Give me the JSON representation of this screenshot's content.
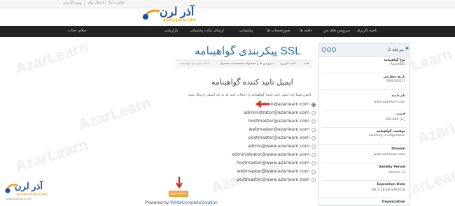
{
  "watermark": {
    "text": "AzarLearn"
  },
  "topbar": {
    "links": [
      "ورود کاربران",
      "ارسال پیام",
      "تماس با ما"
    ]
  },
  "logo": {
    "text": "آذر لرن",
    "subtext": "AZARLEARN.COM"
  },
  "navbar": {
    "items": [
      "ناحیه کاربری",
      "سرویس های من",
      "دامنه ها",
      "صورتحساب ها",
      "پشتیبانی",
      "ارسال تیکت پشتیبانی",
      "بازاریابی",
      "سلام، جناب"
    ]
  },
  "page": {
    "title": "پیکربندی گواهینامه SSL",
    "breadcrumb": [
      "پیکربندی گواهینامه SSL",
      "مشخصات محصول",
      "سرویس ها و محصولات",
      "ناحیه کاربری",
      "خانه"
    ]
  },
  "section": {
    "title": "ایمیل تایید کننده گواهینامه",
    "instruction": "اکنون شما باید ایمیل تایید کننده گواهینامه را انتخاب کنید که به چه ایمیلی ارسال شود."
  },
  "emails": [
    {
      "address": "admin@azarlearn.com",
      "checked": true
    },
    {
      "address": "administrator@azarlearn.com",
      "checked": false
    },
    {
      "address": "hostmaster@azarlearn.com",
      "checked": false
    },
    {
      "address": "webmaster@azarlearn.com",
      "checked": false
    },
    {
      "address": "postmaster@azarlearn.com",
      "checked": false
    },
    {
      "address": "admin@www.azarlearn.com",
      "checked": false
    },
    {
      "address": "administrator@www.azarlearn.com",
      "checked": false
    },
    {
      "address": "hostmaster@www.azarlearn.com",
      "checked": false
    },
    {
      "address": "webmaster@www.azarlearn.com",
      "checked": false
    },
    {
      "address": "postmaster@www.azarlearn.com",
      "checked": false
    }
  ],
  "continue_button": {
    "label": "ادامه خرید »"
  },
  "footer": {
    "prefix": "Powered by ",
    "link": "WHMCompleteSolution"
  },
  "corner_logo": {
    "text": "آذر لرن",
    "subtext": "AZARLEARN.COM",
    "url": "www.azarlearn.com"
  },
  "panel": {
    "title": "مرحله 2",
    "fields": [
      {
        "label": "نوع گواهینامه",
        "value": "RapidSSL"
      },
      {
        "label": "تاریخ سفارش",
        "value": "09/05/2017"
      },
      {
        "label": "نام دامنه",
        "value": "www.azarlearn.com"
      },
      {
        "label": "قیمت",
        "value": "300,000 ریال"
      },
      {
        "label": "موقعیت گواهینامه",
        "value": "Awaiting Configuration"
      },
      {
        "label": "Domain",
        "value": "www.azarlearn.com"
      },
      {
        "label": "Validity Period",
        "value": "Months 12"
      },
      {
        "label": "Expiration Date",
        "value": "AM 3:18:48 5/9/2018"
      },
      {
        "label": "Organization",
        "value": ""
      }
    ]
  },
  "colors": {
    "accent": "#2b6ea3",
    "navbar": "#222222",
    "button": "#f0ad4e",
    "arrow": "#e0211b"
  }
}
